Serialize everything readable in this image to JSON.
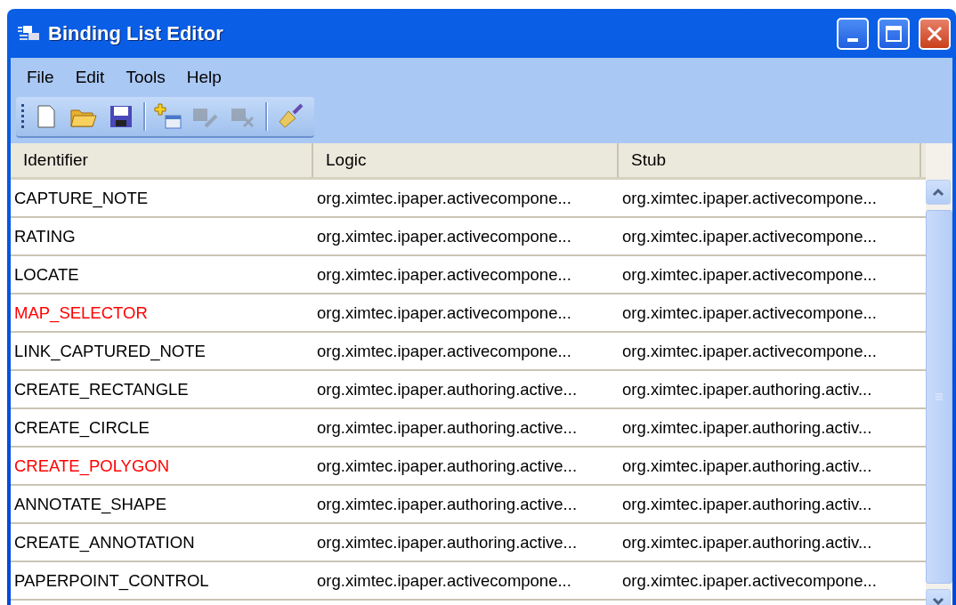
{
  "window": {
    "title": "Binding List Editor"
  },
  "menu": [
    "File",
    "Edit",
    "Tools",
    "Help"
  ],
  "toolbar": [
    {
      "kind": "new",
      "disabled": false
    },
    {
      "kind": "open",
      "disabled": false
    },
    {
      "kind": "save",
      "disabled": false
    },
    {
      "kind": "separator"
    },
    {
      "kind": "add",
      "disabled": false
    },
    {
      "kind": "edit",
      "disabled": true
    },
    {
      "kind": "delete",
      "disabled": true
    },
    {
      "kind": "separator"
    },
    {
      "kind": "clean",
      "disabled": false
    }
  ],
  "table": {
    "columns": [
      "Identifier",
      "Logic",
      "Stub"
    ],
    "rows": [
      {
        "identifier": "CAPTURE_NOTE",
        "color": "#000000",
        "logic": "org.ximtec.ipaper.activecompone...",
        "stub": "org.ximtec.ipaper.activecompone..."
      },
      {
        "identifier": "RATING",
        "color": "#000000",
        "logic": "org.ximtec.ipaper.activecompone...",
        "stub": "org.ximtec.ipaper.activecompone..."
      },
      {
        "identifier": "LOCATE",
        "color": "#000000",
        "logic": "org.ximtec.ipaper.activecompone...",
        "stub": "org.ximtec.ipaper.activecompone..."
      },
      {
        "identifier": "MAP_SELECTOR",
        "color": "#ff0000",
        "logic": "org.ximtec.ipaper.activecompone...",
        "stub": "org.ximtec.ipaper.activecompone..."
      },
      {
        "identifier": "LINK_CAPTURED_NOTE",
        "color": "#000000",
        "logic": "org.ximtec.ipaper.activecompone...",
        "stub": "org.ximtec.ipaper.activecompone..."
      },
      {
        "identifier": "CREATE_RECTANGLE",
        "color": "#000000",
        "logic": "org.ximtec.ipaper.authoring.active...",
        "stub": "org.ximtec.ipaper.authoring.activ..."
      },
      {
        "identifier": "CREATE_CIRCLE",
        "color": "#000000",
        "logic": "org.ximtec.ipaper.authoring.active...",
        "stub": "org.ximtec.ipaper.authoring.activ..."
      },
      {
        "identifier": "CREATE_POLYGON",
        "color": "#ff0000",
        "logic": "org.ximtec.ipaper.authoring.active...",
        "stub": "org.ximtec.ipaper.authoring.activ..."
      },
      {
        "identifier": "ANNOTATE_SHAPE",
        "color": "#000000",
        "logic": "org.ximtec.ipaper.authoring.active...",
        "stub": "org.ximtec.ipaper.authoring.activ..."
      },
      {
        "identifier": "CREATE_ANNOTATION",
        "color": "#000000",
        "logic": "org.ximtec.ipaper.authoring.active...",
        "stub": "org.ximtec.ipaper.authoring.activ..."
      },
      {
        "identifier": "PAPERPOINT_CONTROL",
        "color": "#000000",
        "logic": "org.ximtec.ipaper.activecompone...",
        "stub": "org.ximtec.ipaper.activecompone..."
      }
    ]
  }
}
